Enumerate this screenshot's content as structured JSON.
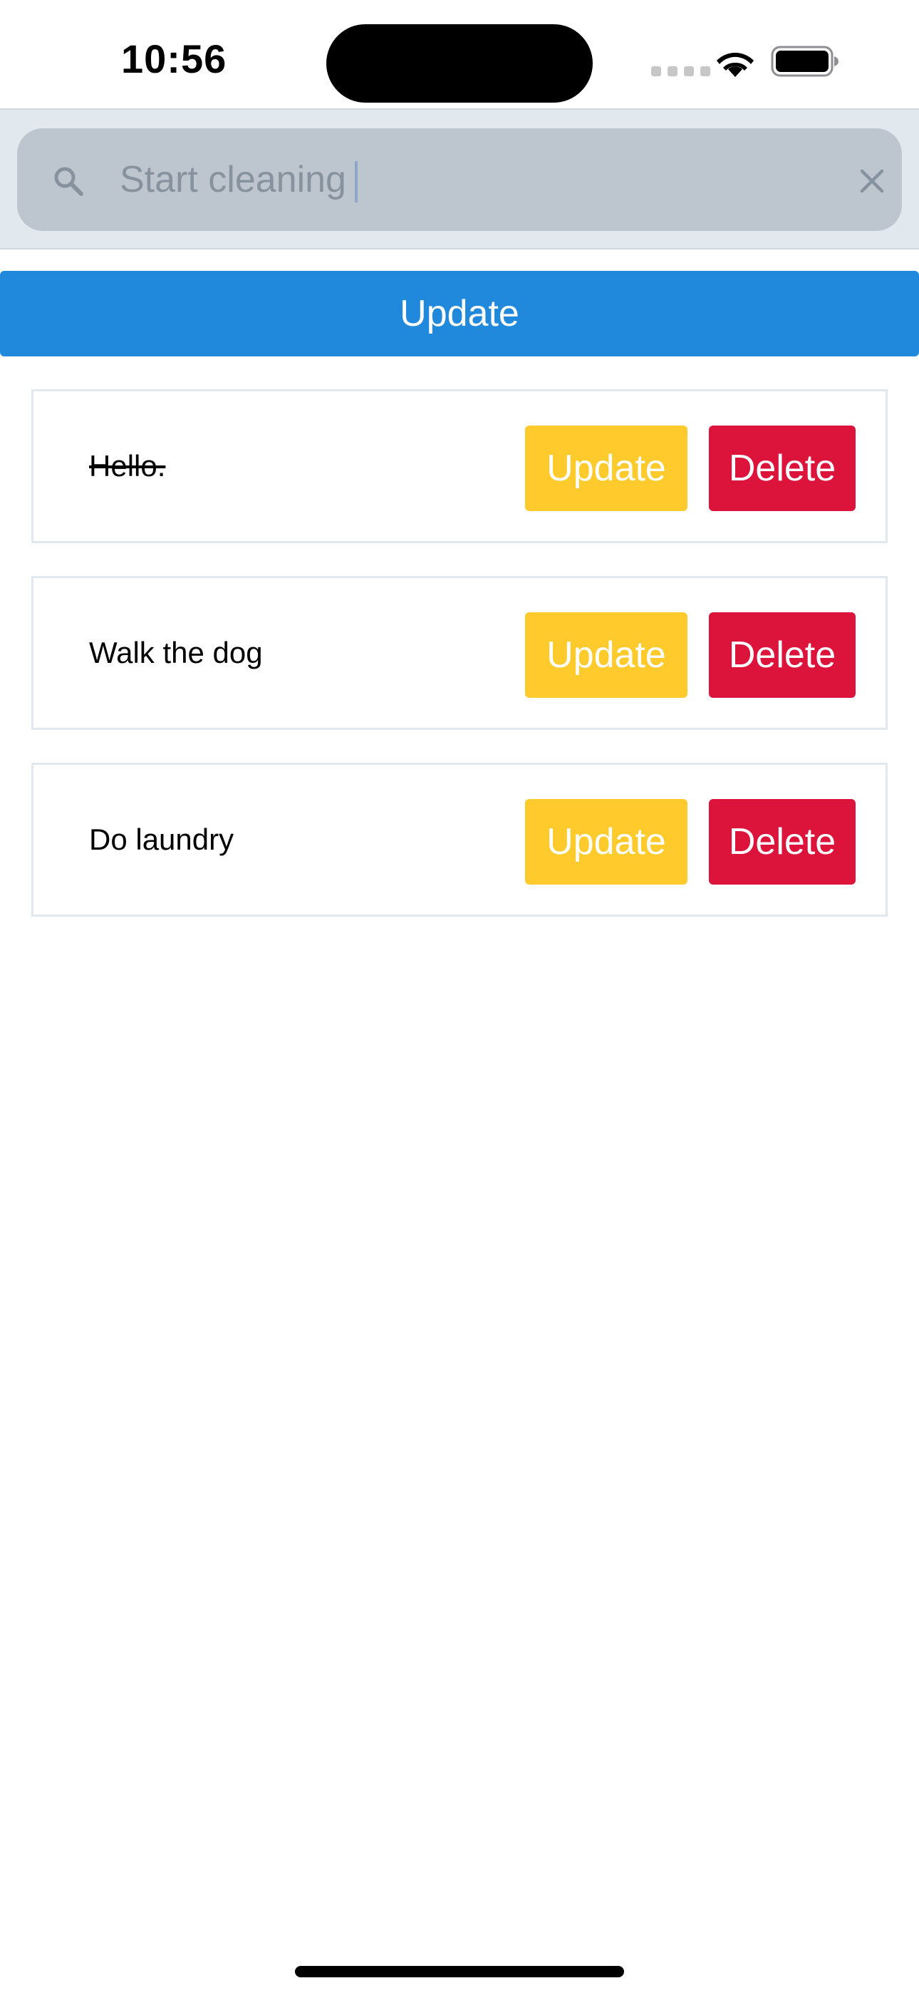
{
  "status_bar": {
    "time": "10:56"
  },
  "search": {
    "placeholder": "Start cleaning",
    "value": ""
  },
  "main_button": {
    "label": "Update",
    "color": "#2089dc"
  },
  "todos": [
    {
      "text": "Hello.",
      "completed": true,
      "update_label": "Update",
      "delete_label": "Delete"
    },
    {
      "text": "Walk the dog",
      "completed": false,
      "update_label": "Update",
      "delete_label": "Delete"
    },
    {
      "text": "Do laundry",
      "completed": false,
      "update_label": "Update",
      "delete_label": "Delete"
    }
  ],
  "colors": {
    "update": "#ffca2c",
    "delete": "#dc143c",
    "search_bg": "#e1e8ee",
    "search_box": "#bdc6cf"
  }
}
